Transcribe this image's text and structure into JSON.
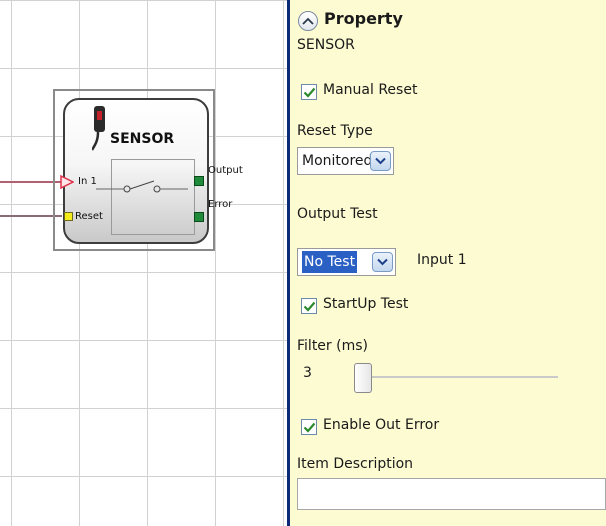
{
  "block": {
    "title": "SENSOR",
    "pins": {
      "in1": "In 1",
      "reset": "Reset",
      "output": "Output",
      "error": "Error"
    }
  },
  "panel": {
    "title": "Property",
    "subtitle": "SENSOR",
    "manual_reset": {
      "label": "Manual Reset",
      "checked": true
    },
    "reset_type": {
      "label": "Reset Type",
      "value": "Monitored"
    },
    "output_test": {
      "label": "Output Test",
      "value": "No Test",
      "input_label": "Input 1"
    },
    "startup_test": {
      "label": "StartUp Test",
      "checked": true
    },
    "filter": {
      "label": "Filter (ms)",
      "value": "3"
    },
    "enable_out_error": {
      "label": "Enable Out Error",
      "checked": true
    },
    "item_description": {
      "label": "Item Description",
      "value": ""
    }
  },
  "icons": {
    "collapse": "chevron-up-icon",
    "dropdown": "chevron-down-icon",
    "check": "checkmark-icon",
    "sensor": "photoelectric-sensor-icon"
  },
  "colors": {
    "panel_bg": "#fdfbd2",
    "divider": "#0c2a77",
    "selection": "#2a5fc4",
    "check_mark": "#2c8a2c",
    "output_pin": "#1f8a3a",
    "reset_pin": "#f5ec1c",
    "input_arrow": "#e0304a"
  }
}
